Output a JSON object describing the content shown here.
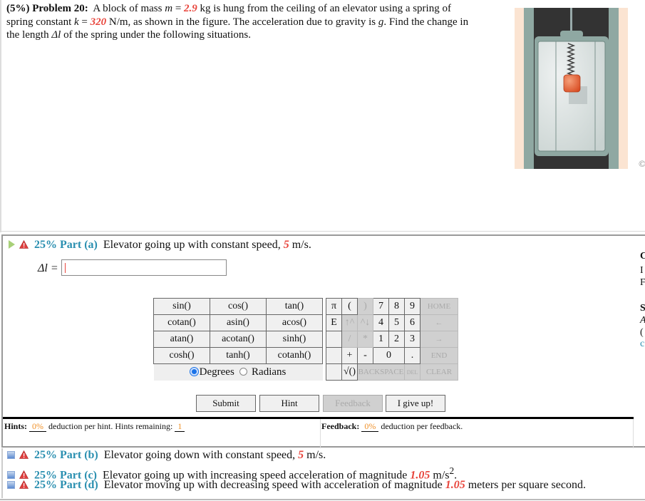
{
  "problem": {
    "weight": "(5%)",
    "title": "Problem 20:",
    "text_1": "A block of mass ",
    "m_var": "m",
    "eq": " = ",
    "mass_value": "2.9",
    "text_2": " kg is hung from the ceiling of an elevator using a spring of spring constant ",
    "k_var": "k",
    "k_value": "320",
    "text_3": " N/m, as shown in the figure. The acceleration due to gravity is ",
    "g_var": "g",
    "text_4": ". Find the change in the length ",
    "dl_var": "Δl",
    "text_5": " of the spring under the following situations.",
    "copyright": "©"
  },
  "part_a": {
    "pct": "25% Part (a)",
    "text": "Elevator going up with constant speed, ",
    "value": "5",
    "unit": " m/s.",
    "answer_label": "Δl = ",
    "answer_value": ""
  },
  "calculator": {
    "functions": [
      [
        "sin()",
        "cos()",
        "tan()"
      ],
      [
        "cotan()",
        "asin()",
        "acos()"
      ],
      [
        "atan()",
        "acotan()",
        "sinh()"
      ],
      [
        "cosh()",
        "tanh()",
        "cotanh()"
      ]
    ],
    "keys": [
      [
        "π",
        "(",
        ")",
        "7",
        "8",
        "9",
        "HOME"
      ],
      [
        "E",
        "↑^",
        "^↓",
        "4",
        "5",
        "6",
        "←"
      ],
      [
        "",
        "/",
        "*",
        "1",
        "2",
        "3",
        "→"
      ],
      [
        "",
        "+",
        "-",
        "0",
        ".",
        "END"
      ],
      [
        "",
        "√()",
        "BACKSPACE",
        "DEL",
        "CLEAR"
      ]
    ],
    "degrees_label": "Degrees",
    "radians_label": "Radians",
    "mode_selected": "Degrees"
  },
  "buttons": {
    "submit": "Submit",
    "hint": "Hint",
    "feedback": "Feedback",
    "give_up": "I give up!"
  },
  "hints": {
    "label": "Hints:",
    "deduction": "0%",
    "text": "deduction per hint. Hints remaining:",
    "remaining": "1"
  },
  "feedback": {
    "label": "Feedback:",
    "deduction": "0%",
    "text": "deduction per feedback."
  },
  "other_parts": [
    {
      "pct": "25% Part (b)",
      "text": "Elevator going down with constant speed, ",
      "value": "5",
      "unit": " m/s.",
      "sup": ""
    },
    {
      "pct": "25% Part (c)",
      "text": "Elevator going up with increasing speed acceleration of magnitude ",
      "value": "1.05",
      "unit": " m/s",
      "sup": "2",
      "tail": "."
    },
    {
      "pct": "25% Part (d)",
      "text": "Elevator moving up with decreasing speed with acceleration of magnitude ",
      "value": "1.05",
      "unit": " meters per square second.",
      "sup": ""
    }
  ],
  "right_clip": [
    "C",
    "I",
    "F",
    "S",
    "A",
    "(",
    "c"
  ]
}
